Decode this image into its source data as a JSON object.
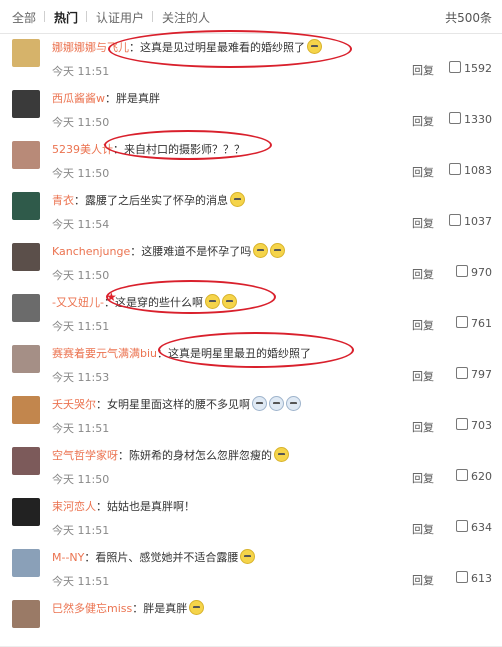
{
  "tabs": {
    "all": "全部",
    "hot": "热门",
    "verified": "认证用户",
    "following": "关注的人",
    "total": "共500条"
  },
  "comments": [
    {
      "user": "娜娜娜娜与飞儿",
      "text": "：这真是见过明星最难看的婚纱照了",
      "time": "今天 11:51",
      "reply": "回复",
      "likes": "1592",
      "avatar_color": "#d6b36a"
    },
    {
      "user": "西瓜酱酱w",
      "text": "：胖是真胖",
      "time": "今天 11:50",
      "reply": "回复",
      "likes": "1330",
      "avatar_color": "#3a3a3a"
    },
    {
      "user": "5239美人计",
      "text": "：来自村口的摄影师？？？",
      "time": "今天 11:50",
      "reply": "回复",
      "likes": "1083",
      "avatar_color": "#b88a78"
    },
    {
      "user": "青衣",
      "text": "：露腰了之后坐实了怀孕的消息",
      "time": "今天 11:54",
      "reply": "回复",
      "likes": "1037",
      "avatar_color": "#2f5a4a"
    },
    {
      "user": "Kanchenjunge",
      "text": "：这腰难道不是怀孕了吗",
      "time": "今天 11:50",
      "reply": "回复",
      "likes": "970",
      "avatar_color": "#5b4f4a"
    },
    {
      "user": "-又又妞儿-",
      "text": "：这是穿的些什么啊",
      "time": "今天 11:51",
      "reply": "回复",
      "likes": "761",
      "avatar_color": "#6b6b6b"
    },
    {
      "user": "赛赛着要元气满满biu",
      "text": "：这真是明星里最丑的婚纱照了",
      "time": "今天 11:53",
      "reply": "回复",
      "likes": "797",
      "avatar_color": "#a58f86"
    },
    {
      "user": "夭夭哭尔",
      "text": "：女明星里面这样的腰不多见啊",
      "time": "今天 11:51",
      "reply": "回复",
      "likes": "703",
      "avatar_color": "#c2864d"
    },
    {
      "user": "空气哲学家呀",
      "text": "：陈妍希的身材怎么忽胖忽瘦的",
      "time": "今天 11:50",
      "reply": "回复",
      "likes": "620",
      "avatar_color": "#7c5a5a"
    },
    {
      "user": "束河恋人",
      "text": "：姑姑也是真胖啊！",
      "time": "今天 11:51",
      "reply": "回复",
      "likes": "634",
      "avatar_color": "#222222"
    },
    {
      "user": "M--NY",
      "text": "：看照片、感觉她并不适合露腰",
      "time": "今天 11:51",
      "reply": "回复",
      "likes": "613",
      "avatar_color": "#8aa0b8"
    },
    {
      "user": "巳然多健忘miss",
      "text": "：胖是真胖",
      "time": "",
      "reply": "",
      "likes": "",
      "avatar_color": "#9a7a66"
    }
  ]
}
